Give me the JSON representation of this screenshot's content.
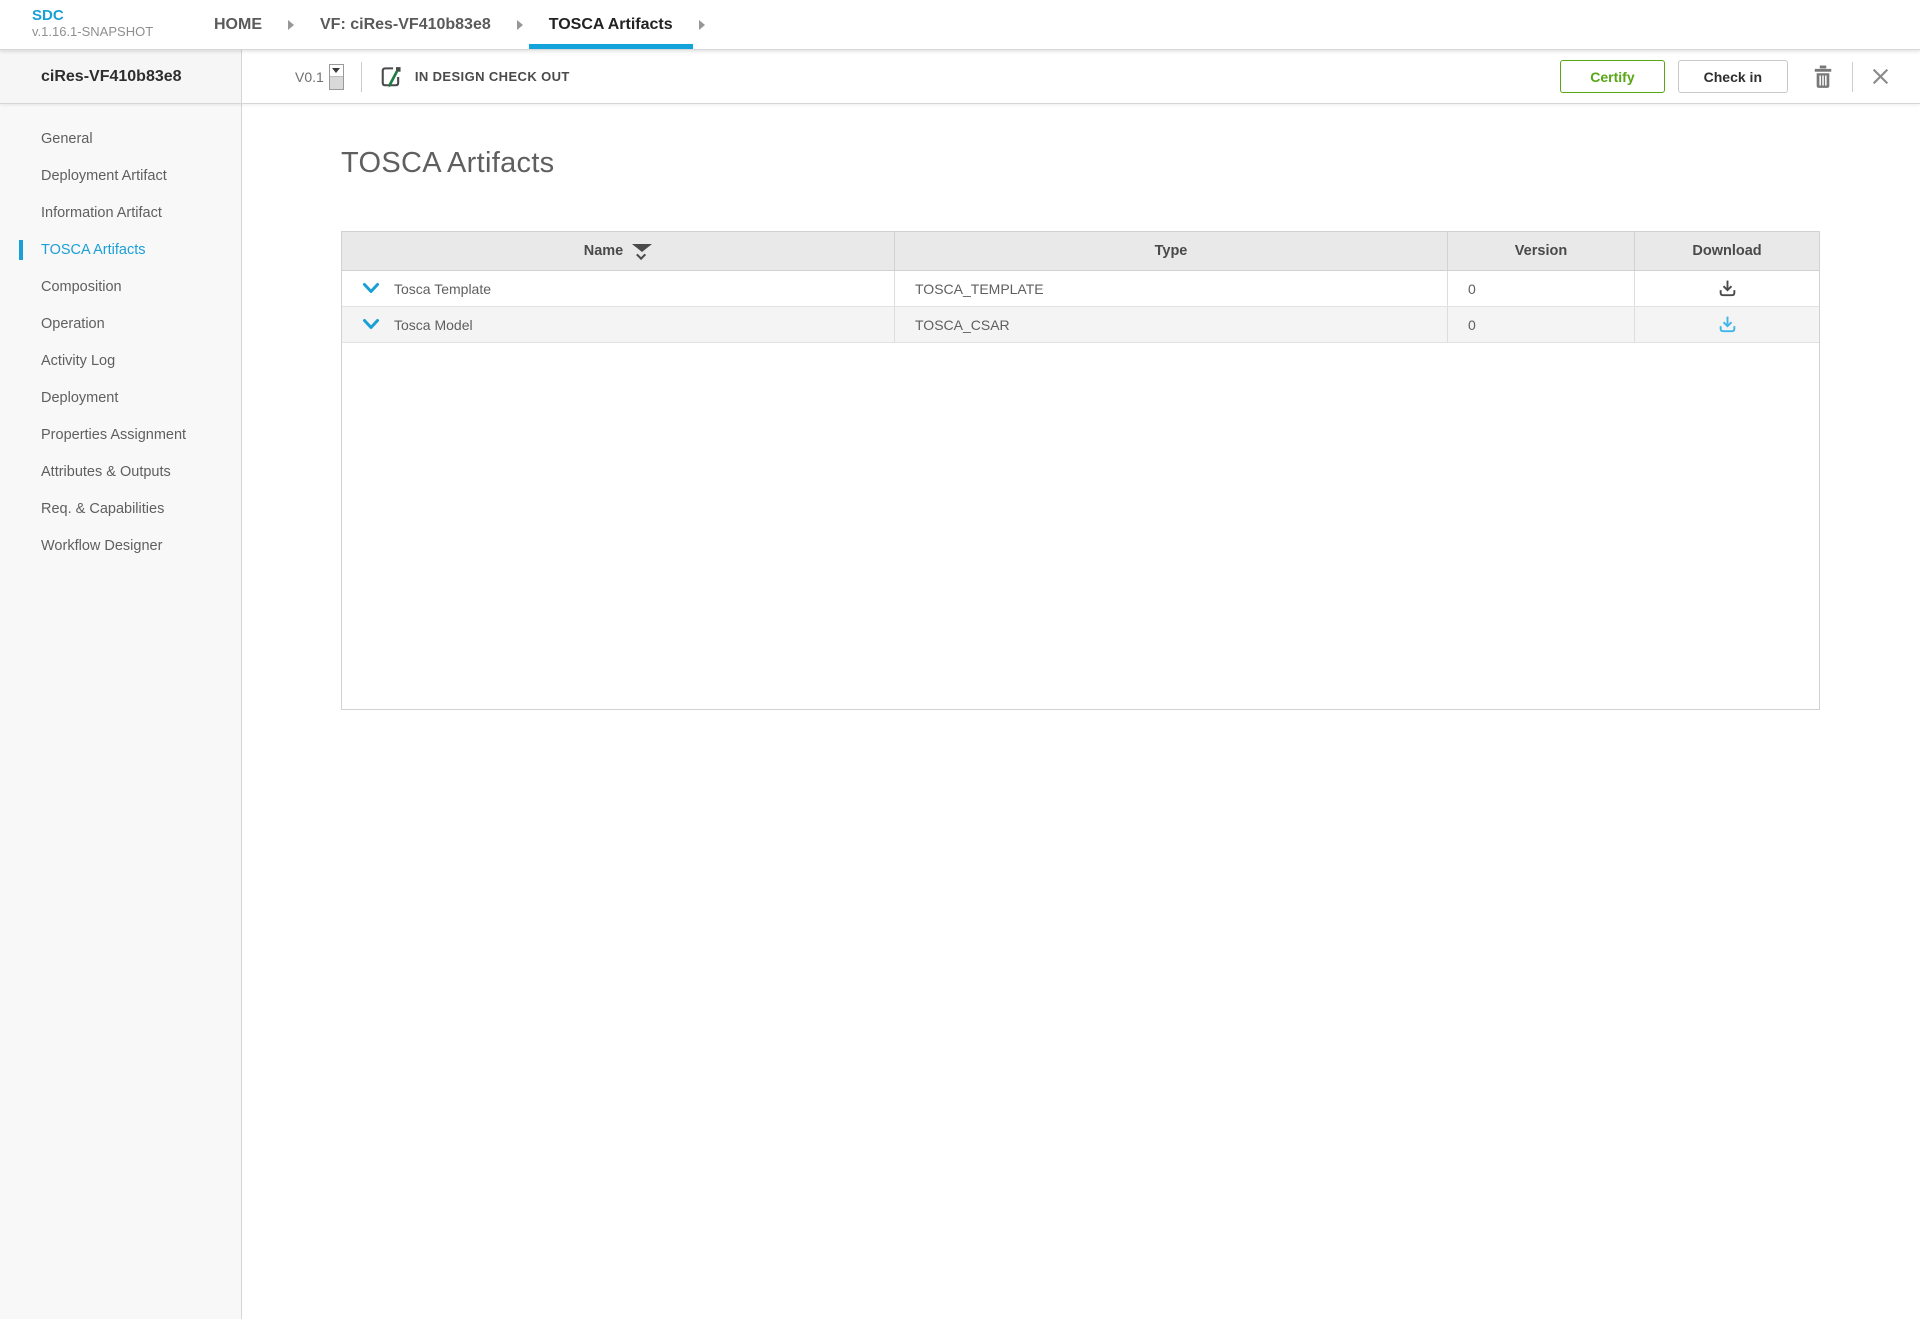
{
  "app": {
    "logo": "SDC",
    "version": "v.1.16.1-SNAPSHOT"
  },
  "breadcrumbs": {
    "home": "HOME",
    "vf": "VF: ciRes-VF410b83e8",
    "current": "TOSCA Artifacts"
  },
  "entity": {
    "name": "ciRes-VF410b83e8"
  },
  "toolbar": {
    "version": "V0.1",
    "lifecycle_state": "IN DESIGN CHECK OUT",
    "certify_label": "Certify",
    "checkin_label": "Check in",
    "icons": [
      "edit-in-design-icon",
      "trash-icon",
      "close-icon"
    ]
  },
  "sidebar": {
    "items": [
      {
        "label": "General"
      },
      {
        "label": "Deployment Artifact"
      },
      {
        "label": "Information Artifact"
      },
      {
        "label": "TOSCA Artifacts",
        "active": true
      },
      {
        "label": "Composition"
      },
      {
        "label": "Operation"
      },
      {
        "label": "Activity Log"
      },
      {
        "label": "Deployment"
      },
      {
        "label": "Properties Assignment"
      },
      {
        "label": "Attributes & Outputs"
      },
      {
        "label": "Req. & Capabilities"
      },
      {
        "label": "Workflow Designer"
      }
    ]
  },
  "main": {
    "title": "TOSCA Artifacts",
    "table": {
      "columns": [
        "Name",
        "Type",
        "Version",
        "Download"
      ],
      "rows": [
        {
          "name": "Tosca Template",
          "type": "TOSCA_TEMPLATE",
          "version": "0",
          "download_icon": "download-icon"
        },
        {
          "name": "Tosca Model",
          "type": "TOSCA_CSAR",
          "version": "0",
          "download_icon": "download-icon"
        }
      ]
    }
  },
  "colors": {
    "accent_blue": "#1a9fd6",
    "underline_blue": "#15a3dc",
    "download_blue": "#3fb6e8",
    "certify_green": "#57a616",
    "pencil_green": "#1e7e45",
    "sidebar_bg": "#f8f8f8",
    "table_header_bg": "#e9e9e9",
    "row_alt_bg": "#f4f4f4"
  }
}
